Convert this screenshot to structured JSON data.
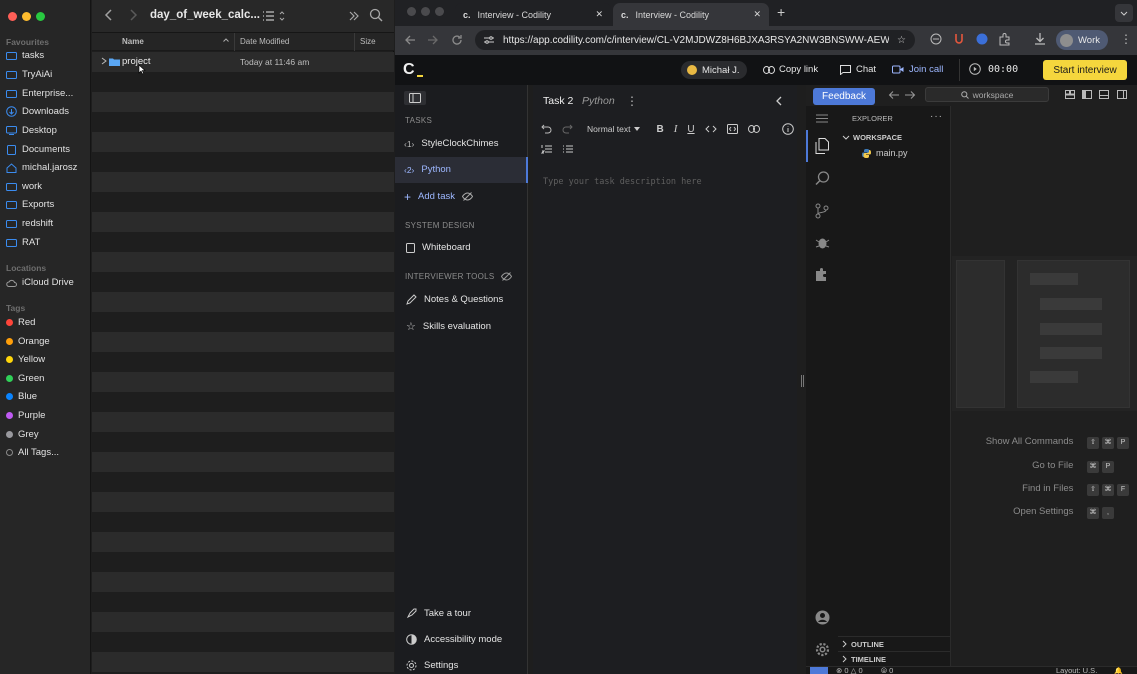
{
  "finder": {
    "title": "day_of_week_calc...",
    "sections": {
      "favourites": "Favourites",
      "locations": "Locations",
      "tags": "Tags"
    },
    "favourites": [
      "tasks",
      "TryAiAi",
      "Enterprise...",
      "Downloads",
      "Desktop",
      "Documents",
      "michal.jarosz",
      "work",
      "Exports",
      "redshift",
      "RAT"
    ],
    "locations": [
      "iCloud Drive"
    ],
    "tags": [
      {
        "label": "Red",
        "color": "#ff453a"
      },
      {
        "label": "Orange",
        "color": "#ff9f0a"
      },
      {
        "label": "Yellow",
        "color": "#ffd60a"
      },
      {
        "label": "Green",
        "color": "#30d158"
      },
      {
        "label": "Blue",
        "color": "#0a84ff"
      },
      {
        "label": "Purple",
        "color": "#bf5af2"
      },
      {
        "label": "Grey",
        "color": "#98989d"
      }
    ],
    "all_tags": "All Tags...",
    "columns": {
      "name": "Name",
      "date": "Date Modified",
      "size": "Size"
    },
    "rows": [
      {
        "name": "project",
        "date": "Today at 11:46 am"
      }
    ]
  },
  "browser": {
    "tabs": [
      {
        "title": "Interview - Codility"
      },
      {
        "title": "Interview - Codility"
      }
    ],
    "url": "https://app.codility.com/c/interview/CL-V2MJDWZ8H6BJXA3RSYA2NW3BNSWW-AEW/",
    "profile": "Work"
  },
  "codility": {
    "logo": "C",
    "user": "Michał J.",
    "copy_link": "Copy link",
    "chat": "Chat",
    "join_call": "Join call",
    "timer": "00:00",
    "start_interview": "Start interview",
    "tasks_heading": "TASKS",
    "tasks": [
      {
        "badge": "1",
        "label": "StyleClockChimes"
      },
      {
        "badge": "2",
        "label": "Python"
      }
    ],
    "add_task": "Add task",
    "system_design_heading": "SYSTEM DESIGN",
    "whiteboard": "Whiteboard",
    "interviewer_tools_heading": "INTERVIEWER TOOLS",
    "notes": "Notes & Questions",
    "skills": "Skills evaluation",
    "take_tour": "Take a tour",
    "accessibility": "Accessibility mode",
    "settings": "Settings",
    "task_title": "Task 2",
    "task_lang": "Python",
    "text_style": "Normal text",
    "description_placeholder": "Type your task description here",
    "accent": "#4d79d8",
    "start_color": "#f5d63d"
  },
  "vscode": {
    "feedback": "Feedback",
    "search_placeholder": "workspace",
    "explorer_title": "EXPLORER",
    "workspace": "WORKSPACE",
    "file": "main.py",
    "outline": "OUTLINE",
    "timeline": "TIMELINE",
    "hints": [
      {
        "label": "Show All Commands",
        "keys": [
          "⇧",
          "⌘",
          "P"
        ]
      },
      {
        "label": "Go to File",
        "keys": [
          "⌘",
          "P"
        ]
      },
      {
        "label": "Find in Files",
        "keys": [
          "⇧",
          "⌘",
          "F"
        ]
      },
      {
        "label": "Open Settings",
        "keys": [
          "⌘",
          ","
        ]
      }
    ],
    "status_errors": "0",
    "status_warnings": "0",
    "status_ports": "0",
    "status_layout": "Layout: U.S."
  }
}
